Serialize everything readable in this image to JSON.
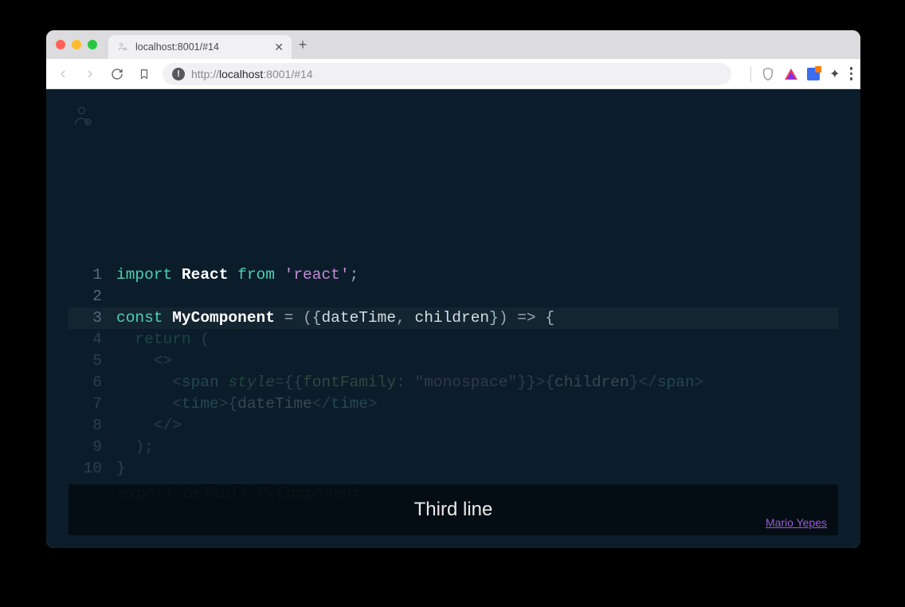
{
  "tab": {
    "title": "localhost:8001/#14"
  },
  "url": {
    "prefix": "http://",
    "host": "localhost",
    "rest": ":8001/#14"
  },
  "code": {
    "lines": [
      {
        "n": "1",
        "tokens": [
          [
            "kw",
            "import"
          ],
          [
            "sp",
            " "
          ],
          [
            "id-bold",
            "React"
          ],
          [
            "sp",
            " "
          ],
          [
            "fr",
            "from"
          ],
          [
            "sp",
            " "
          ],
          [
            "str",
            "'react'"
          ],
          [
            "punc",
            ";"
          ]
        ]
      },
      {
        "n": "2",
        "tokens": []
      },
      {
        "n": "3",
        "hl": true,
        "tokens": [
          [
            "kw",
            "const"
          ],
          [
            "sp",
            " "
          ],
          [
            "id-bold",
            "MyComponent"
          ],
          [
            "sp",
            " "
          ],
          [
            "punc",
            "="
          ],
          [
            "sp",
            " "
          ],
          [
            "punc",
            "("
          ],
          [
            "brace",
            "{"
          ],
          [
            "param",
            "dateTime"
          ],
          [
            "punc",
            ","
          ],
          [
            "sp",
            " "
          ],
          [
            "param",
            "children"
          ],
          [
            "brace",
            "}"
          ],
          [
            "punc",
            ")"
          ],
          [
            "sp",
            " "
          ],
          [
            "punc",
            "=>"
          ],
          [
            "sp",
            " "
          ],
          [
            "brace",
            "{"
          ]
        ]
      },
      {
        "n": "4",
        "dim": true,
        "tokens": [
          [
            "sp",
            "  "
          ],
          [
            "ret",
            "return"
          ],
          [
            "sp",
            " "
          ],
          [
            "punc",
            "("
          ]
        ]
      },
      {
        "n": "5",
        "dim": true,
        "tokens": [
          [
            "sp",
            "    "
          ],
          [
            "punc",
            "<"
          ],
          [
            "punc",
            ">"
          ]
        ]
      },
      {
        "n": "6",
        "dim": true,
        "tokens": [
          [
            "sp",
            "      "
          ],
          [
            "punc",
            "<"
          ],
          [
            "tag",
            "span"
          ],
          [
            "sp",
            " "
          ],
          [
            "attr",
            "style"
          ],
          [
            "punc",
            "="
          ],
          [
            "brace",
            "{{"
          ],
          [
            "prop",
            "fontFamily"
          ],
          [
            "punc",
            ":"
          ],
          [
            "sp",
            " "
          ],
          [
            "val",
            "\"monospace\""
          ],
          [
            "brace",
            "}}"
          ],
          [
            "punc",
            ">"
          ],
          [
            "brace",
            "{"
          ],
          [
            "param",
            "children"
          ],
          [
            "brace",
            "}"
          ],
          [
            "punc",
            "</"
          ],
          [
            "tag",
            "span"
          ],
          [
            "punc",
            ">"
          ]
        ]
      },
      {
        "n": "7",
        "dim": true,
        "tokens": [
          [
            "sp",
            "      "
          ],
          [
            "punc",
            "<"
          ],
          [
            "tag",
            "time"
          ],
          [
            "punc",
            ">"
          ],
          [
            "brace",
            "{"
          ],
          [
            "param",
            "dateTime"
          ],
          [
            "punc",
            "</"
          ],
          [
            "tag",
            "time"
          ],
          [
            "punc",
            ">"
          ]
        ]
      },
      {
        "n": "8",
        "dim": true,
        "tokens": [
          [
            "sp",
            "    "
          ],
          [
            "punc",
            "</"
          ],
          [
            "punc",
            ">"
          ]
        ]
      },
      {
        "n": "9",
        "dim": true,
        "tokens": [
          [
            "sp",
            "  "
          ],
          [
            "punc",
            ")"
          ],
          [
            "punc",
            ";"
          ]
        ]
      },
      {
        "n": "10",
        "dim": true,
        "tokens": [
          [
            "brace",
            "}"
          ]
        ]
      }
    ],
    "faded_export": "export default MyComponent;"
  },
  "caption": {
    "text": "Third line",
    "credit": "Mario Yepes"
  }
}
